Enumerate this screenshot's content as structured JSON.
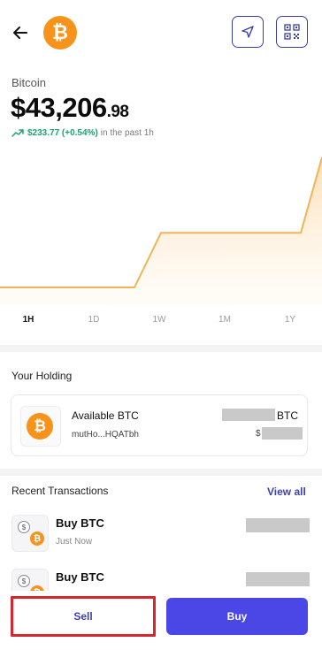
{
  "header": {
    "back_icon": "arrow-left-icon",
    "coin_symbol_glyph": "₿",
    "send_icon": "send-icon",
    "qr_icon": "qr-code-icon"
  },
  "asset": {
    "name": "Bitcoin",
    "price_main": "$43,206",
    "price_cents": ".98",
    "change_amount": "$233.77 (+0.54%)",
    "change_period": "in the past 1h",
    "change_color": "#1aa36f"
  },
  "chart_data": {
    "type": "area",
    "x": [
      0,
      1,
      2,
      3,
      4,
      5
    ],
    "values": [
      0,
      0,
      0.42,
      0.42,
      0.42,
      1.0
    ],
    "color": "#f0b45a"
  },
  "ranges": [
    "1H",
    "1D",
    "1W",
    "1M",
    "1Y"
  ],
  "active_range": "1H",
  "holding": {
    "section_title": "Your Holding",
    "label": "Available BTC",
    "address": "mutHo...HQATbh",
    "unit": "BTC",
    "fiat_prefix": "$"
  },
  "transactions": {
    "section_title": "Recent Transactions",
    "view_all_label": "View all",
    "items": [
      {
        "title": "Buy BTC",
        "subtitle": "Just Now"
      },
      {
        "title": "Buy BTC",
        "subtitle": ""
      }
    ]
  },
  "actions": {
    "sell_label": "Sell",
    "buy_label": "Buy",
    "accent": "#4a47e6"
  }
}
